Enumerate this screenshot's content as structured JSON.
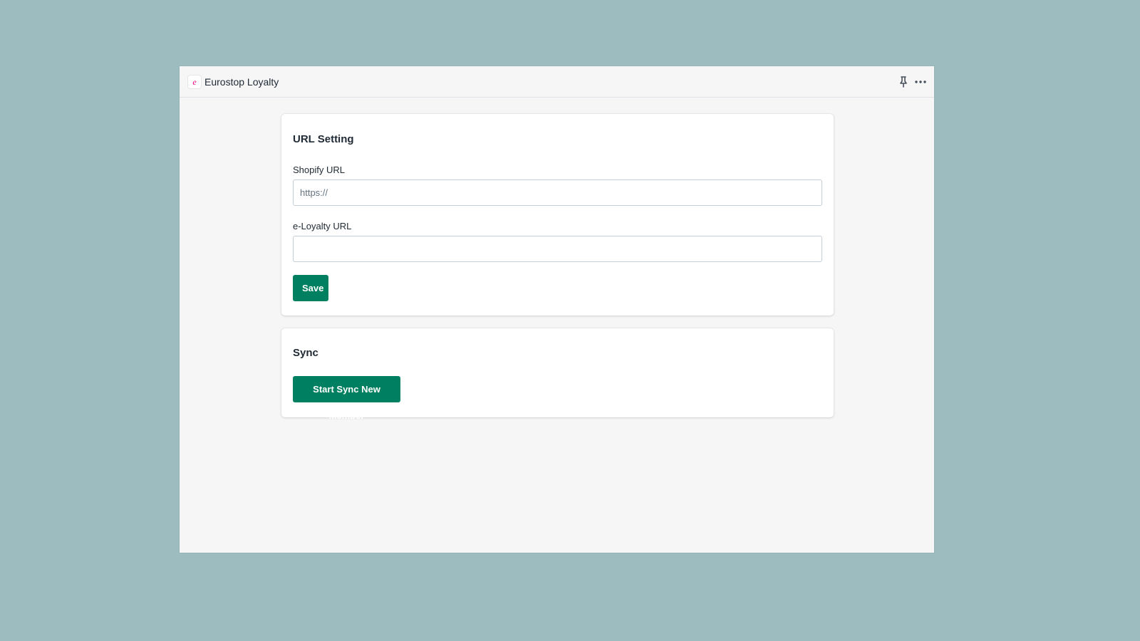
{
  "header": {
    "logo_glyph": "e",
    "app_title": "Eurostop Loyalty",
    "icons": [
      "pin-icon",
      "more-horizontal-icon"
    ]
  },
  "url_setting": {
    "title": "URL Setting",
    "shopify_url": {
      "label": "Shopify URL",
      "value": "",
      "placeholder": "https://"
    },
    "eloyalty_url": {
      "label": "e-Loyalty URL",
      "value": "",
      "placeholder": ""
    },
    "save_label": "Save"
  },
  "sync": {
    "title": "Sync",
    "start_label": "Start Sync New Member"
  },
  "colors": {
    "backdrop": "#9dbcbf",
    "app_background": "#f6f6f7",
    "card_background": "#ffffff",
    "primary_button": "#008060",
    "logo_accent": "#e6007e"
  }
}
